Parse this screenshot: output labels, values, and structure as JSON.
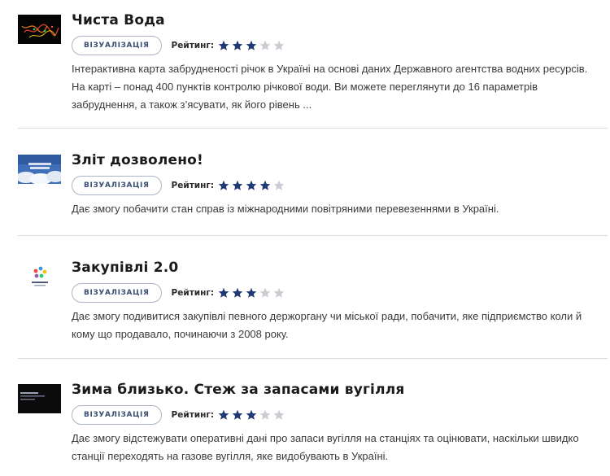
{
  "items": [
    {
      "title": "Чиста Вода",
      "tag": "ВІЗУАЛІЗАЦІЯ",
      "rating_label": "Рейтинг:",
      "rating": 3,
      "rating_max": 5,
      "description": "Інтерактивна карта забрудненості річок в Україні на основі даних Державного агентства водних ресурсів. На карті – понад 400 пунктів контролю річкової води. Ви можете переглянути до 16 параметрів забруднення, а також з’ясувати, як його рівень ..."
    },
    {
      "title": "Зліт дозволено!",
      "tag": "ВІЗУАЛІЗАЦІЯ",
      "rating_label": "Рейтинг:",
      "rating": 4,
      "rating_max": 5,
      "description": "Дає змогу побачити стан справ із міжнародними повітряними перевезеннями в Україні."
    },
    {
      "title": "Закупівлі 2.0",
      "tag": "ВІЗУАЛІЗАЦІЯ",
      "rating_label": "Рейтинг:",
      "rating": 3,
      "rating_max": 5,
      "description": "Дає змогу подивитися закупівлі певного держоргану чи міської ради, побачити, яке підприємство коли й кому що продавало, починаючи з 2008 року."
    },
    {
      "title": "Зима близько. Стеж за запасами вугілля",
      "tag": "ВІЗУАЛІЗАЦІЯ",
      "rating_label": "Рейтинг:",
      "rating": 3,
      "rating_max": 5,
      "description": "Дає змогу відстежувати оперативні дані про запаси вугілля на станціях та оцінювати, наскільки швидко станції переходять на газове вугілля, яке видобувають в Україні."
    }
  ],
  "colors": {
    "star_filled": "#1f3a72",
    "star_empty": "#c9ccd2",
    "tag_border": "#aab4c4",
    "tag_text": "#3b4f73",
    "divider": "#d9dde3"
  }
}
